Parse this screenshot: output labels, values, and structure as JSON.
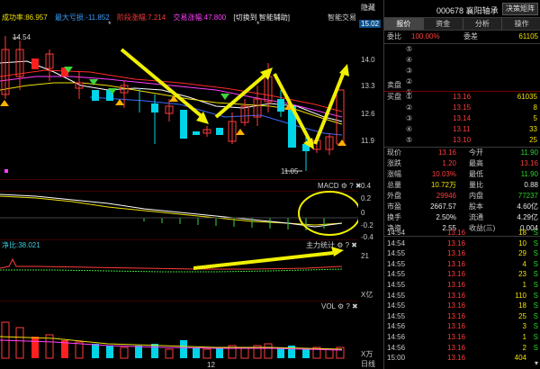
{
  "top_stats": {
    "success_rate": "成功率:86.957",
    "max_profit": "最大亏损:-11.852",
    "stage_gain": "阶段涨幅:7.214",
    "trade_gain": "交易涨幅:47.800",
    "switch_tools": "[切换到 智能辅助]"
  },
  "chart_labels": {
    "smart_trade": "智能交易",
    "high_label": "14.54",
    "low_label": "11.05",
    "macd_title": "MACD",
    "flow_title_left": "净比:38.021",
    "flow_title_right": "主力统计",
    "vol_title": "VOL",
    "date_label": "12",
    "panel_icons": "⚙ ? ✖"
  },
  "price_scale": {
    "top_badge": "隐藏",
    "price_badge": "15.02",
    "main": [
      "14.0",
      "13.3",
      "12.6",
      "11.9"
    ],
    "macd": [
      "0.4",
      "0.2",
      "0",
      "-0.2",
      "-0.4"
    ],
    "flow": [
      "21",
      "",
      "",
      "",
      "",
      "X亿"
    ],
    "vol": [
      "",
      "X万",
      "日线"
    ]
  },
  "quote": {
    "code": "000678",
    "name": "襄阳轴承",
    "detail_button": "决策矩阵",
    "tabs": [
      "报价",
      "资金",
      "分析",
      "操作"
    ],
    "ratio_label": "委比",
    "ratio_value": "100.00%",
    "diff_label": "委差",
    "diff_value": "61105",
    "sell_label": "卖盘",
    "buy_label": "买盘",
    "sell_rows": [
      {
        "idx": "⑤",
        "price": "",
        "vol": ""
      },
      {
        "idx": "④",
        "price": "",
        "vol": ""
      },
      {
        "idx": "③",
        "price": "",
        "vol": ""
      },
      {
        "idx": "②",
        "price": "",
        "vol": ""
      },
      {
        "idx": "①",
        "price": "",
        "vol": ""
      }
    ],
    "buy_rows": [
      {
        "idx": "①",
        "price": "13.16",
        "vol": "61035"
      },
      {
        "idx": "②",
        "price": "13.15",
        "vol": "8"
      },
      {
        "idx": "③",
        "price": "13.14",
        "vol": "5"
      },
      {
        "idx": "④",
        "price": "13.11",
        "vol": "33"
      },
      {
        "idx": "⑤",
        "price": "13.10",
        "vol": "25"
      }
    ],
    "stats": [
      {
        "l1": "现价",
        "v1": "13.16",
        "c1": "red",
        "l2": "今开",
        "v2": "11.90",
        "c2": "green"
      },
      {
        "l1": "涨跌",
        "v1": "1.20",
        "c1": "red",
        "l2": "最高",
        "v2": "13.16",
        "c2": "red"
      },
      {
        "l1": "涨幅",
        "v1": "10.03%",
        "c1": "red",
        "l2": "最低",
        "v2": "11.90",
        "c2": "green"
      },
      {
        "l1": "总量",
        "v1": "10.72万",
        "c1": "yellow",
        "l2": "量比",
        "v2": "0.88",
        "c2": "white"
      },
      {
        "l1": "外盘",
        "v1": "29946",
        "c1": "red",
        "l2": "内盘",
        "v2": "77237",
        "c2": "green"
      },
      {
        "l1": "市盈",
        "v1": "2667.57",
        "c1": "white",
        "l2": "股本",
        "v2": "4.60亿",
        "c2": "white"
      },
      {
        "l1": "换手",
        "v1": "2.50%",
        "c1": "white",
        "l2": "流通",
        "v2": "4.29亿",
        "c2": "white"
      },
      {
        "l1": "净资",
        "v1": "2.55",
        "c1": "white",
        "l2": "收益(三)",
        "v2": "0.004",
        "c2": "white"
      }
    ],
    "trades": [
      {
        "t": "14:54",
        "p": "13.16",
        "v": "18",
        "d": "S"
      },
      {
        "t": "14:54",
        "p": "13.16",
        "v": "10",
        "d": "S"
      },
      {
        "t": "14:55",
        "p": "13.16",
        "v": "29",
        "d": "S"
      },
      {
        "t": "14:55",
        "p": "13.16",
        "v": "4",
        "d": "S"
      },
      {
        "t": "14:55",
        "p": "13.16",
        "v": "23",
        "d": "S"
      },
      {
        "t": "14:55",
        "p": "13.16",
        "v": "1",
        "d": "S"
      },
      {
        "t": "14:55",
        "p": "13.16",
        "v": "110",
        "d": "S"
      },
      {
        "t": "14:55",
        "p": "13.16",
        "v": "18",
        "d": "S"
      },
      {
        "t": "14:55",
        "p": "13.16",
        "v": "25",
        "d": "S"
      },
      {
        "t": "14:56",
        "p": "13.16",
        "v": "3",
        "d": "S"
      },
      {
        "t": "14:56",
        "p": "13.16",
        "v": "1",
        "d": "S"
      },
      {
        "t": "14:56",
        "p": "13.16",
        "v": "2",
        "d": "S"
      },
      {
        "t": "15:00",
        "p": "13.16",
        "v": "404",
        "d": ""
      }
    ]
  }
}
